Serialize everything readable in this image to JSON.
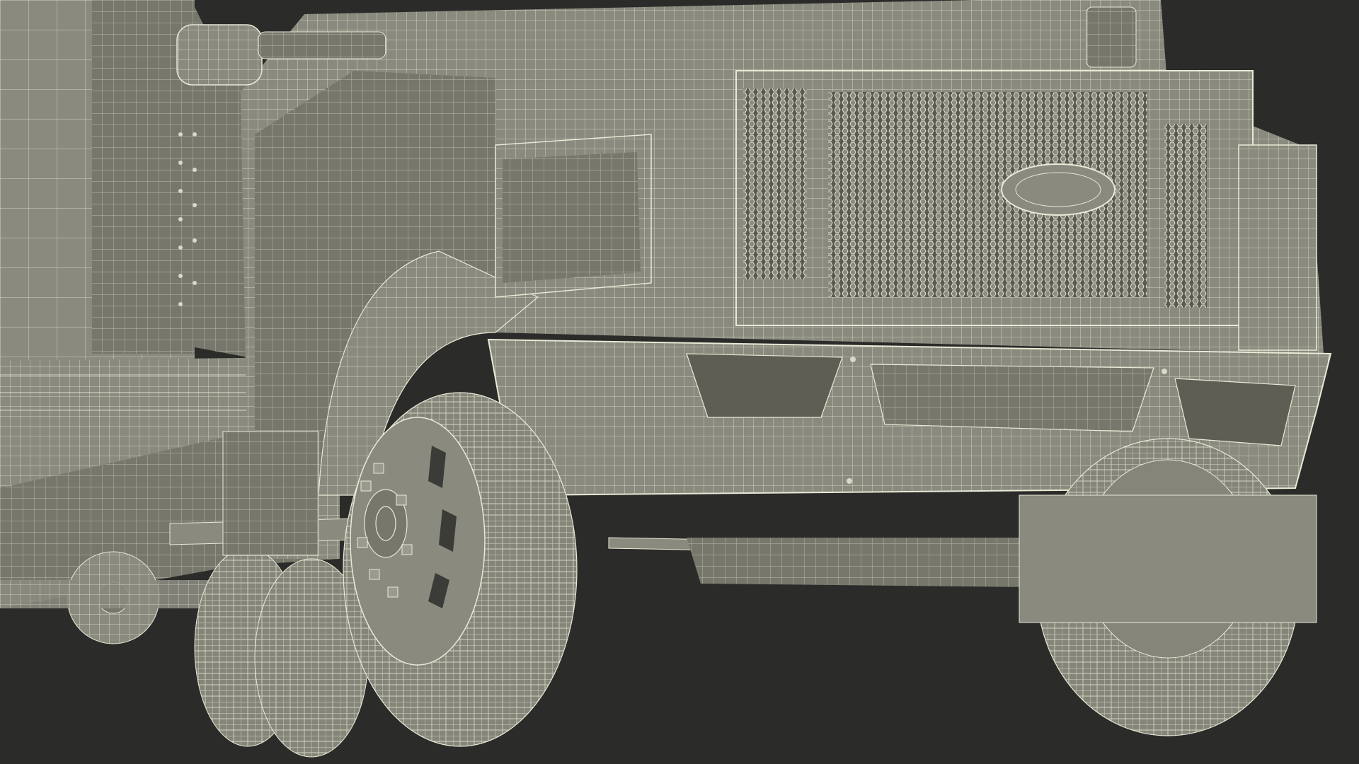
{
  "scene": {
    "subject": "truck-front-wireframe-render",
    "colors": {
      "background": "#2b2b2a",
      "surface": "#8a8a7e",
      "surface_dark": "#77776c",
      "surface_light": "#97978b",
      "wire": "#e9e9d6",
      "shadow": "#5e5e55"
    }
  }
}
